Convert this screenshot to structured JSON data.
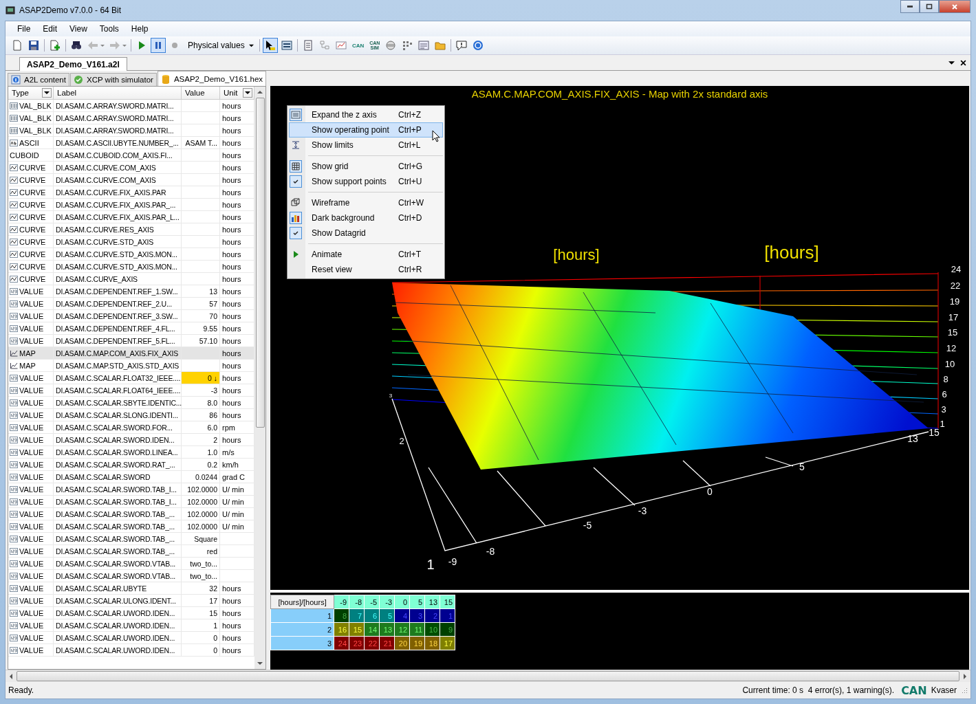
{
  "window": {
    "title": "ASAP2Demo v7.0.0 - 64 Bit"
  },
  "menu": [
    "File",
    "Edit",
    "View",
    "Tools",
    "Help"
  ],
  "toolbar": [
    {
      "kind": "new",
      "pressed": false
    },
    {
      "kind": "save",
      "pressed": false
    },
    {
      "kind": "separator"
    },
    {
      "kind": "add",
      "pressed": false
    },
    {
      "kind": "separator"
    },
    {
      "kind": "find",
      "pressed": false
    },
    {
      "kind": "back",
      "pressed": false
    },
    {
      "kind": "drop"
    },
    {
      "kind": "forward",
      "pressed": false
    },
    {
      "kind": "drop"
    },
    {
      "kind": "separator"
    },
    {
      "kind": "play",
      "pressed": false
    },
    {
      "kind": "pause",
      "pressed": true
    },
    {
      "kind": "record",
      "pressed": false
    },
    {
      "kind": "dropdown",
      "label": "Physical values"
    },
    {
      "kind": "separator"
    },
    {
      "kind": "pointer",
      "pressed": true
    },
    {
      "kind": "panel",
      "pressed": false
    },
    {
      "kind": "separator"
    },
    {
      "kind": "doc",
      "pressed": false
    },
    {
      "kind": "tree",
      "pressed": false
    },
    {
      "kind": "chart",
      "pressed": false
    },
    {
      "kind": "can",
      "label": "CAN",
      "pressed": false
    },
    {
      "kind": "can-sim",
      "label": "CAN SIM",
      "pressed": false
    },
    {
      "kind": "disk",
      "pressed": false
    },
    {
      "kind": "dots",
      "pressed": false
    },
    {
      "kind": "form",
      "pressed": false
    },
    {
      "kind": "folder",
      "pressed": false
    },
    {
      "kind": "separator"
    },
    {
      "kind": "comment",
      "pressed": false
    },
    {
      "kind": "help",
      "pressed": false
    }
  ],
  "document_tabs": [
    {
      "label": "ASAP2_Demo_V161.a2l",
      "selected": true
    }
  ],
  "sub_tabs": [
    {
      "label": "A2L content",
      "kind": "info",
      "selected": false
    },
    {
      "label": "XCP with simulator",
      "kind": "ok",
      "selected": false
    },
    {
      "label": "ASAP2_Demo_V161.hex",
      "kind": "db",
      "selected": true
    }
  ],
  "table": {
    "columns": [
      {
        "label": "Type",
        "filter": true
      },
      {
        "label": "Label",
        "filter": false
      },
      {
        "label": "Value",
        "filter": false
      },
      {
        "label": "Unit",
        "filter": true
      }
    ],
    "rows": [
      {
        "kind": "array",
        "type": "VAL_BLK",
        "label": "DI.ASAM.C.ARRAY.SWORD.MATRI...",
        "unit": "hours",
        "selected": false,
        "changed": false
      },
      {
        "kind": "array",
        "type": "VAL_BLK",
        "label": "DI.ASAM.C.ARRAY.SWORD.MATRI...",
        "unit": "hours",
        "selected": false,
        "changed": false
      },
      {
        "kind": "array",
        "type": "VAL_BLK",
        "label": "DI.ASAM.C.ARRAY.SWORD.MATRI...",
        "unit": "hours",
        "selected": false,
        "changed": false
      },
      {
        "kind": "ascii",
        "type": "ASCII",
        "label": "DI.ASAM.C.ASCII.UBYTE.NUMBER_...",
        "value": "ASAM T...",
        "unit": "hours",
        "selected": false,
        "changed": false
      },
      {
        "kind": "cuboid",
        "type": "CUBOID",
        "label": "DI.ASAM.C.CUBOID.COM_AXIS.FI...",
        "unit": "hours",
        "selected": false,
        "changed": false
      },
      {
        "kind": "curve",
        "type": "CURVE",
        "label": "DI.ASAM.C.CURVE.COM_AXIS",
        "unit": "hours",
        "selected": false,
        "changed": false
      },
      {
        "kind": "curve",
        "type": "CURVE",
        "label": "DI.ASAM.C.CURVE.COM_AXIS",
        "unit": "hours",
        "selected": false,
        "changed": false
      },
      {
        "kind": "curve",
        "type": "CURVE",
        "label": "DI.ASAM.C.CURVE.FIX_AXIS.PAR",
        "unit": "hours",
        "selected": false,
        "changed": false
      },
      {
        "kind": "curve",
        "type": "CURVE",
        "label": "DI.ASAM.C.CURVE.FIX_AXIS.PAR_...",
        "unit": "hours",
        "selected": false,
        "changed": false
      },
      {
        "kind": "curve",
        "type": "CURVE",
        "label": "DI.ASAM.C.CURVE.FIX_AXIS.PAR_L...",
        "unit": "hours",
        "selected": false,
        "changed": false
      },
      {
        "kind": "curve",
        "type": "CURVE",
        "label": "DI.ASAM.C.CURVE.RES_AXIS",
        "unit": "hours",
        "selected": false,
        "changed": false
      },
      {
        "kind": "curve",
        "type": "CURVE",
        "label": "DI.ASAM.C.CURVE.STD_AXIS",
        "unit": "hours",
        "selected": false,
        "changed": false
      },
      {
        "kind": "curve",
        "type": "CURVE",
        "label": "DI.ASAM.C.CURVE.STD_AXIS.MON...",
        "unit": "hours",
        "selected": false,
        "changed": false
      },
      {
        "kind": "curve",
        "type": "CURVE",
        "label": "DI.ASAM.C.CURVE.STD_AXIS.MON...",
        "unit": "hours",
        "selected": false,
        "changed": false
      },
      {
        "kind": "curve",
        "type": "CURVE",
        "label": "DI.ASAM.C.CURVE_AXIS",
        "unit": "hours",
        "selected": false,
        "changed": false
      },
      {
        "kind": "value",
        "type": "VALUE",
        "label": "DI.ASAM.C.DEPENDENT.REF_1.SW...",
        "value": "13",
        "unit": "hours",
        "selected": false,
        "changed": false
      },
      {
        "kind": "value",
        "type": "VALUE",
        "label": "DI.ASAM.C.DEPENDENT.REF_2.U...",
        "value": "57",
        "unit": "hours",
        "selected": false,
        "changed": false
      },
      {
        "kind": "value",
        "type": "VALUE",
        "label": "DI.ASAM.C.DEPENDENT.REF_3.SW...",
        "value": "70",
        "unit": "hours",
        "selected": false,
        "changed": false
      },
      {
        "kind": "value",
        "type": "VALUE",
        "label": "DI.ASAM.C.DEPENDENT.REF_4.FL...",
        "value": "9.55",
        "unit": "hours",
        "selected": false,
        "changed": false
      },
      {
        "kind": "value",
        "type": "VALUE",
        "label": "DI.ASAM.C.DEPENDENT.REF_5.FL...",
        "value": "57.10",
        "unit": "hours",
        "selected": false,
        "changed": false
      },
      {
        "kind": "map",
        "type": "MAP",
        "label": "DI.ASAM.C.MAP.COM_AXIS.FIX_AXIS",
        "unit": "hours",
        "selected": true,
        "changed": false
      },
      {
        "kind": "map",
        "type": "MAP",
        "label": "DI.ASAM.C.MAP.STD_AXIS.STD_AXIS",
        "unit": "hours",
        "selected": false,
        "changed": false
      },
      {
        "kind": "value",
        "type": "VALUE",
        "label": "DI.ASAM.C.SCALAR.FLOAT32_IEEE....",
        "value": "0 ↓",
        "unit": "hours",
        "selected": false,
        "changed": true
      },
      {
        "kind": "value",
        "type": "VALUE",
        "label": "DI.ASAM.C.SCALAR.FLOAT64_IEEE....",
        "value": "-3",
        "unit": "hours",
        "selected": false,
        "changed": false
      },
      {
        "kind": "value",
        "type": "VALUE",
        "label": "DI.ASAM.C.SCALAR.SBYTE.IDENTIC...",
        "value": "8.0",
        "unit": "hours",
        "selected": false,
        "changed": false
      },
      {
        "kind": "value",
        "type": "VALUE",
        "label": "DI.ASAM.C.SCALAR.SLONG.IDENTI...",
        "value": "86",
        "unit": "hours",
        "selected": false,
        "changed": false
      },
      {
        "kind": "value",
        "type": "VALUE",
        "label": "DI.ASAM.C.SCALAR.SWORD.FOR...",
        "value": "6.0",
        "unit": "rpm",
        "selected": false,
        "changed": false
      },
      {
        "kind": "value",
        "type": "VALUE",
        "label": "DI.ASAM.C.SCALAR.SWORD.IDEN...",
        "value": "2",
        "unit": "hours",
        "selected": false,
        "changed": false
      },
      {
        "kind": "value",
        "type": "VALUE",
        "label": "DI.ASAM.C.SCALAR.SWORD.LINEA...",
        "value": "1.0",
        "unit": "m/s",
        "selected": false,
        "changed": false
      },
      {
        "kind": "value",
        "type": "VALUE",
        "label": "DI.ASAM.C.SCALAR.SWORD.RAT_...",
        "value": "0.2",
        "unit": "km/h",
        "selected": false,
        "changed": false
      },
      {
        "kind": "value",
        "type": "VALUE",
        "label": "DI.ASAM.C.SCALAR.SWORD",
        "value": "0.0244",
        "unit": "grad C",
        "selected": false,
        "changed": false
      },
      {
        "kind": "value",
        "type": "VALUE",
        "label": "DI.ASAM.C.SCALAR.SWORD.TAB_I...",
        "value": "102.0000",
        "unit": "U/  min",
        "selected": false,
        "changed": false
      },
      {
        "kind": "value",
        "type": "VALUE",
        "label": "DI.ASAM.C.SCALAR.SWORD.TAB_I...",
        "value": "102.0000",
        "unit": "U/  min",
        "selected": false,
        "changed": false
      },
      {
        "kind": "value",
        "type": "VALUE",
        "label": "DI.ASAM.C.SCALAR.SWORD.TAB_...",
        "value": "102.0000",
        "unit": "U/  min",
        "selected": false,
        "changed": false
      },
      {
        "kind": "value",
        "type": "VALUE",
        "label": "DI.ASAM.C.SCALAR.SWORD.TAB_...",
        "value": "102.0000",
        "unit": "U/  min",
        "selected": false,
        "changed": false
      },
      {
        "kind": "value",
        "type": "VALUE",
        "label": "DI.ASAM.C.SCALAR.SWORD.TAB_...",
        "value": "Square",
        "selected": false,
        "changed": false
      },
      {
        "kind": "value",
        "type": "VALUE",
        "label": "DI.ASAM.C.SCALAR.SWORD.TAB_...",
        "value": "red",
        "selected": false,
        "changed": false
      },
      {
        "kind": "value",
        "type": "VALUE",
        "label": "DI.ASAM.C.SCALAR.SWORD.VTAB...",
        "value": "two_to...",
        "selected": false,
        "changed": false
      },
      {
        "kind": "value",
        "type": "VALUE",
        "label": "DI.ASAM.C.SCALAR.SWORD.VTAB...",
        "value": "two_to...",
        "selected": false,
        "changed": false
      },
      {
        "kind": "value",
        "type": "VALUE",
        "label": "DI.ASAM.C.SCALAR.UBYTE",
        "value": "32",
        "unit": "hours",
        "selected": false,
        "changed": false
      },
      {
        "kind": "value",
        "type": "VALUE",
        "label": "DI.ASAM.C.SCALAR.ULONG.IDENT...",
        "value": "17",
        "unit": "hours",
        "selected": false,
        "changed": false
      },
      {
        "kind": "value",
        "type": "VALUE",
        "label": "DI.ASAM.C.SCALAR.UWORD.IDEN...",
        "value": "15",
        "unit": "hours",
        "selected": false,
        "changed": false
      },
      {
        "kind": "value",
        "type": "VALUE",
        "label": "DI.ASAM.C.SCALAR.UWORD.IDEN...",
        "value": "1",
        "unit": "hours",
        "selected": false,
        "changed": false
      },
      {
        "kind": "value",
        "type": "VALUE",
        "label": "DI.ASAM.C.SCALAR.UWORD.IDEN...",
        "value": "0",
        "unit": "hours",
        "selected": false,
        "changed": false
      },
      {
        "kind": "value",
        "type": "VALUE",
        "label": "DI.ASAM.C.SCALAR.UWORD.IDEN...",
        "value": "0",
        "unit": "hours",
        "selected": false,
        "changed": false
      }
    ]
  },
  "plot": {
    "title": "ASAM.C.MAP.COM_AXIS.FIX_AXIS - Map with 2x standard axis",
    "axis_titles": [
      "[hours]",
      "[hours]"
    ],
    "z_ticks": [
      "24",
      "22",
      "19",
      "17",
      "15",
      "12",
      "10",
      "8",
      "6",
      "3",
      "1"
    ],
    "x_ticks": [
      "-9",
      "-8",
      "-5",
      "-3",
      "0",
      "5",
      "13",
      "15"
    ],
    "y_ticks": [
      "1",
      "2",
      "3"
    ]
  },
  "context_menu": {
    "groups": [
      [
        {
          "label": "Expand the z axis",
          "shortcut": "Ctrl+Z",
          "checked": true,
          "highlighted": false
        },
        {
          "label": "Show operating point",
          "shortcut": "Ctrl+P",
          "highlighted": true
        },
        {
          "label": "Show limits",
          "shortcut": "Ctrl+L",
          "checked": false,
          "highlighted": false
        }
      ],
      [
        {
          "label": "Show grid",
          "shortcut": "Ctrl+G",
          "checked": true,
          "highlighted": false
        },
        {
          "label": "Show support points",
          "shortcut": "Ctrl+U",
          "checked": true,
          "highlighted": false
        }
      ],
      [
        {
          "label": "Wireframe",
          "shortcut": "Ctrl+W",
          "checked": false,
          "highlighted": false
        },
        {
          "label": "Dark background",
          "shortcut": "Ctrl+D",
          "checked": true,
          "highlighted": false
        },
        {
          "label": "Show Datagrid",
          "checked": true,
          "highlighted": false
        }
      ],
      [
        {
          "label": "Animate",
          "shortcut": "Ctrl+T",
          "checked": false,
          "highlighted": false
        },
        {
          "label": "Reset view",
          "shortcut": "Ctrl+R",
          "highlighted": false
        }
      ]
    ]
  },
  "datagrid": {
    "corner": "[hours]/[hours]",
    "columns": [
      "-9",
      "-8",
      "-5",
      "-3",
      "0",
      "5",
      "13",
      "15"
    ],
    "rows": [
      {
        "label": "1",
        "cells": [
          {
            "text": "8",
            "color": "#004000"
          },
          {
            "text": "7",
            "color": "#008080"
          },
          {
            "text": "6",
            "color": "#008080"
          },
          {
            "text": "5",
            "color": "#008080"
          },
          {
            "text": "4",
            "color": "#000090"
          },
          {
            "text": "3",
            "color": "#000090"
          },
          {
            "text": "2",
            "color": "#000090"
          },
          {
            "text": "1",
            "color": "#000090"
          }
        ]
      },
      {
        "label": "2",
        "cells": [
          {
            "text": "16",
            "color": "#808000"
          },
          {
            "text": "15",
            "color": "#808000"
          },
          {
            "text": "14",
            "color": "#1e7a1e"
          },
          {
            "text": "13",
            "color": "#1e7a1e"
          },
          {
            "text": "12",
            "color": "#1e7a1e"
          },
          {
            "text": "11",
            "color": "#1e7a1e"
          },
          {
            "text": "10",
            "color": "#004c00"
          },
          {
            "text": "9",
            "color": "#004000"
          }
        ]
      },
      {
        "label": "3",
        "cells": [
          {
            "text": "24",
            "color": "#800000"
          },
          {
            "text": "23",
            "color": "#800000"
          },
          {
            "text": "22",
            "color": "#800000"
          },
          {
            "text": "21",
            "color": "#800000"
          },
          {
            "text": "20",
            "color": "#806000"
          },
          {
            "text": "19",
            "color": "#806000"
          },
          {
            "text": "18",
            "color": "#806000"
          },
          {
            "text": "17",
            "color": "#808000"
          }
        ]
      }
    ]
  },
  "status_bar": {
    "message": "Ready.",
    "info": "Current time: 0 s  4 error(s), 1 warning(s).",
    "logo": "CAN",
    "device": "Kvaser"
  }
}
